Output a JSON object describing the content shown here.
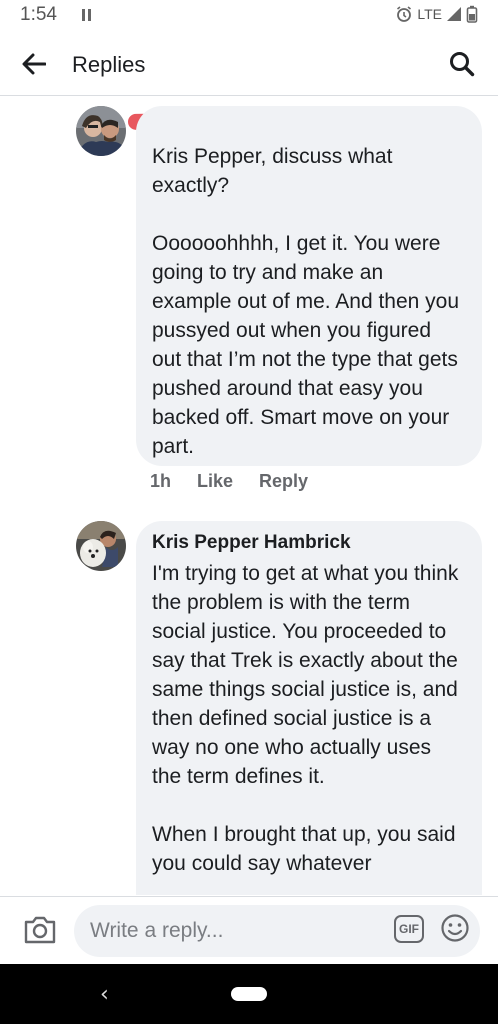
{
  "status_bar": {
    "time": "1:54",
    "network": "LTE"
  },
  "header": {
    "title": "Replies"
  },
  "comments": [
    {
      "author": "",
      "text": "Kris Pepper, discuss what exactly?\n\nOooooohhhh, I get it. You were going to try and make an example out of me. And then you pussyed out when you figured out that I’m not the type that gets pushed around that easy you backed off. Smart move on your part.",
      "time": "1h",
      "like_label": "Like",
      "reply_label": "Reply"
    },
    {
      "author": "Kris Pepper Hambrick",
      "text": "I'm trying to get at what you think the problem is with the term social justice. You proceeded to say that Trek is exactly about the same things social justice is, and then defined social justice is a way no one who actually uses the term defines it.\n\nWhen I brought that up, you said you could say whatever"
    }
  ],
  "composer": {
    "placeholder": "Write a reply...",
    "gif_label": "GIF"
  },
  "colors": {
    "bubble": "#f0f2f5",
    "meta": "#65676b",
    "redaction": "#e8575e"
  }
}
